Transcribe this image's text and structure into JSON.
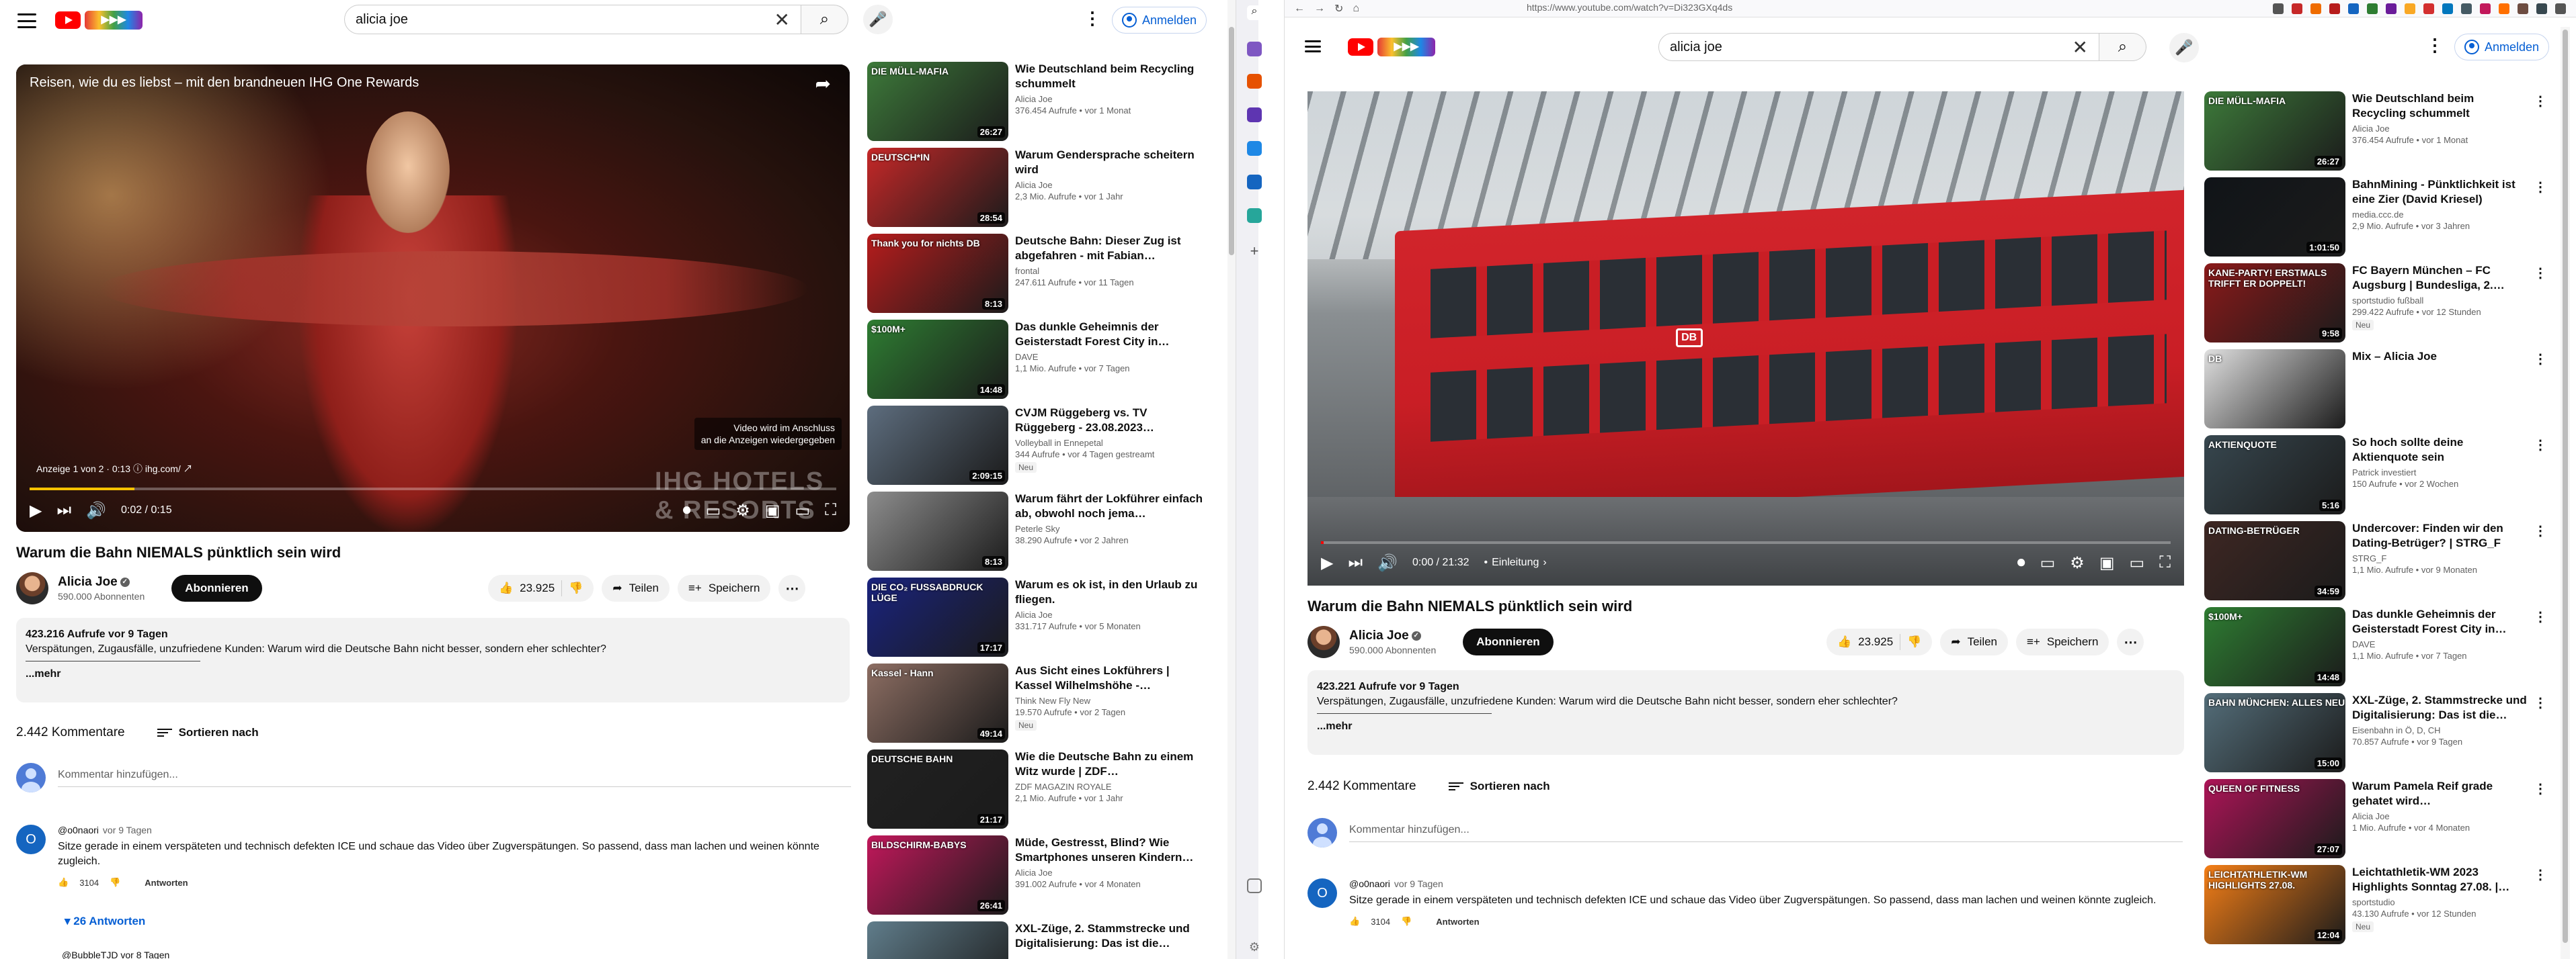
{
  "left": {
    "header": {
      "logo_text": "",
      "search_value": "alicia joe",
      "signin_label": "Anmelden"
    },
    "player": {
      "ad_title": "Reisen, wie du es liebst – mit den brandneuen IHG One Rewards",
      "ad_note_line1": "Video wird im Anschluss",
      "ad_note_line2": "an die Anzeigen wiedergegeben",
      "ad_info": "Anzeige 1 von 2 · 0:13  ⓘ  ihg.com/ ↗",
      "watermark": "IHG  HOTELS & RESORTS",
      "time": "0:02 / 0:15",
      "progress_percent": 13
    },
    "video": {
      "title": "Warum die Bahn NIEMALS pünktlich sein wird",
      "channel": "Alicia Joe",
      "subscribers": "590.000 Abonnenten",
      "subscribe_label": "Abonnieren",
      "likes": "23.925",
      "share_label": "Teilen",
      "save_label": "Speichern",
      "views_date": "423.216 Aufrufe  vor 9 Tagen",
      "description": "Verspätungen, Zugausfälle, unzufriedene Kunden: Warum wird die Deutsche Bahn nicht besser, sondern eher schlechter?",
      "more_label": "...mehr"
    },
    "comments": {
      "count": "2.442 Kommentare",
      "sort_label": "Sortieren nach",
      "add_placeholder": "Kommentar hinzufügen...",
      "first": {
        "avatar_letter": "O",
        "user": "@o0naori",
        "time": "vor 9 Tagen",
        "text": "Sitze gerade in einem verspäteten und technisch defekten ICE und schaue das Video über Zugverspätungen. So passend, dass man lachen und weinen könnte zugleich.",
        "likes": "3104",
        "reply_label": "Antworten"
      },
      "replies_label": "26 Antworten",
      "next_user": "@BubbleTJD  vor 8 Tagen"
    },
    "recommendations": [
      {
        "title": "Wie Deutschland beim Recycling schummelt",
        "channel": "Alicia Joe",
        "meta": "376.454 Aufrufe • vor 1 Monat",
        "duration": "26:27",
        "label": "DIE MÜLL-MAFIA",
        "color": "#3d7a3a",
        "badge": ""
      },
      {
        "title": "Warum Gendersprache scheitern wird",
        "channel": "Alicia Joe",
        "meta": "2,3 Mio. Aufrufe • vor 1 Jahr",
        "duration": "28:54",
        "label": "DEUTSCH*IN",
        "color": "#c62828",
        "badge": ""
      },
      {
        "title": "Deutsche Bahn: Dieser Zug ist abgefahren - mit Fabian…",
        "channel": "frontal",
        "meta": "247.611 Aufrufe • vor 11 Tagen",
        "duration": "8:13",
        "label": "Thank you for nichts DB",
        "color": "#b71c1c",
        "badge": ""
      },
      {
        "title": "Das dunkle Geheimnis der Geisterstadt Forest City in…",
        "channel": "DAVE",
        "meta": "1,1 Mio. Aufrufe • vor 7 Tagen",
        "duration": "14:48",
        "label": "$100M+",
        "color": "#2e7d32",
        "badge": ""
      },
      {
        "title": "CVJM Rüggeberg vs. TV Rüggeberg - 23.08.2023…",
        "channel": "Volleyball in Ennepetal",
        "meta": "344 Aufrufe • vor 4 Tagen gestreamt",
        "duration": "2:09:15",
        "label": "",
        "color": "#5d6d7e",
        "badge": "Neu"
      },
      {
        "title": "Warum fährt der Lokführer einfach ab, obwohl noch jema…",
        "channel": "Peterle Sky",
        "meta": "38.290 Aufrufe • vor 2 Jahren",
        "duration": "8:13",
        "label": "",
        "color": "#8d8d8d",
        "badge": ""
      },
      {
        "title": "Warum es ok ist, in den Urlaub zu fliegen.",
        "channel": "Alicia Joe",
        "meta": "331.717 Aufrufe • vor 5 Monaten",
        "duration": "17:17",
        "label": "DIE CO₂ FUSSABDRUCK LÜGE",
        "color": "#1a237e",
        "badge": ""
      },
      {
        "title": "Aus Sicht eines Lokführers | Kassel Wilhelmshöhe -…",
        "channel": "Think New Fly New",
        "meta": "19.570 Aufrufe • vor 2 Tagen",
        "duration": "49:14",
        "label": "Kassel - Hann",
        "color": "#8d6e63",
        "badge": "Neu"
      },
      {
        "title": "Wie die Deutsche Bahn zu einem Witz wurde | ZDF…",
        "channel": "ZDF MAGAZIN ROYALE",
        "meta": "2,1 Mio. Aufrufe • vor 1 Jahr",
        "duration": "21:17",
        "label": "DEUTSCHE BAHN",
        "color": "#212121",
        "badge": ""
      },
      {
        "title": "Müde, Gestresst, Blind? Wie Smartphones unseren Kindern…",
        "channel": "Alicia Joe",
        "meta": "391.002 Aufrufe • vor 4 Monaten",
        "duration": "26:41",
        "label": "BILDSCHIRM-BABYS",
        "color": "#c2185b",
        "badge": ""
      },
      {
        "title": "XXL-Züge, 2. Stammstrecke und Digitalisierung: Das ist die…",
        "channel": "",
        "meta": "",
        "duration": "",
        "label": "",
        "color": "#607d8b",
        "badge": ""
      }
    ]
  },
  "right": {
    "browser": {
      "url": "https://www.youtube.com/watch?v=Di323GXq4ds"
    },
    "header": {
      "search_value": "alicia joe",
      "signin_label": "Anmelden"
    },
    "player": {
      "time": "0:00 / 21:32",
      "chapter": "Einleitung",
      "progress_percent": 0
    },
    "video": {
      "title": "Warum die Bahn NIEMALS pünktlich sein wird",
      "channel": "Alicia Joe",
      "subscribers": "590.000 Abonnenten",
      "subscribe_label": "Abonnieren",
      "likes": "23.925",
      "share_label": "Teilen",
      "save_label": "Speichern",
      "views_date": "423.221 Aufrufe  vor 9 Tagen",
      "description": "Verspätungen, Zugausfälle, unzufriedene Kunden: Warum wird die Deutsche Bahn nicht besser, sondern eher schlechter?",
      "more_label": "...mehr"
    },
    "comments": {
      "count": "2.442 Kommentare",
      "sort_label": "Sortieren nach",
      "add_placeholder": "Kommentar hinzufügen...",
      "first": {
        "avatar_letter": "O",
        "user": "@o0naori",
        "time": "vor 9 Tagen",
        "text": "Sitze gerade in einem verspäteten und technisch defekten ICE und schaue das Video über Zugverspätungen. So passend, dass man lachen und weinen könnte zugleich.",
        "likes": "3104",
        "reply_label": "Antworten"
      }
    },
    "recommendations": [
      {
        "title": "Wie Deutschland beim Recycling schummelt",
        "channel": "Alicia Joe",
        "meta": "376.454 Aufrufe • vor 1 Monat",
        "duration": "26:27",
        "label": "DIE MÜLL-MAFIA",
        "color": "#3d7a3a",
        "badge": ""
      },
      {
        "title": "BahnMining - Pünktlichkeit ist eine Zier (David Kriesel)",
        "channel": "media.ccc.de",
        "meta": "2,9 Mio. Aufrufe • vor 3 Jahren",
        "duration": "1:01:50",
        "label": "",
        "color": "#101418",
        "badge": ""
      },
      {
        "title": "FC Bayern München – FC Augsburg | Bundesliga, 2.…",
        "channel": "sportstudio fußball",
        "meta": "299.422 Aufrufe • vor 12 Stunden",
        "duration": "9:58",
        "label": "KANE-PARTY! ERSTMALS TRIFFT ER DOPPELT!",
        "color": "#8b1a1a",
        "badge": "Neu"
      },
      {
        "title": "Mix – Alicia Joe",
        "channel": "",
        "meta": "",
        "duration": "",
        "label": "DB",
        "color": "#e0e0e0",
        "badge": ""
      },
      {
        "title": "So hoch sollte deine Aktienquote sein",
        "channel": "Patrick investiert",
        "meta": "150 Aufrufe • vor 2 Wochen",
        "duration": "5:16",
        "label": "AKTIENQUOTE",
        "color": "#37474f",
        "badge": ""
      },
      {
        "title": "Undercover: Finden wir den Dating-Betrüger? | STRG_F",
        "channel": "STRG_F",
        "meta": "1,1 Mio. Aufrufe • vor 9 Monaten",
        "duration": "34:59",
        "label": "DATING-BETRÜGER",
        "color": "#3e2723",
        "badge": ""
      },
      {
        "title": "Das dunkle Geheimnis der Geisterstadt Forest City in…",
        "channel": "DAVE",
        "meta": "1,1 Mio. Aufrufe • vor 7 Tagen",
        "duration": "14:48",
        "label": "$100M+",
        "color": "#2e7d32",
        "badge": ""
      },
      {
        "title": "XXL-Züge, 2. Stammstrecke und Digitalisierung: Das ist die…",
        "channel": "Eisenbahn in Ö, D, CH",
        "meta": "70.857 Aufrufe • vor 9 Tagen",
        "duration": "15:00",
        "label": "BAHN MÜNCHEN: ALLES NEU",
        "color": "#546e7a",
        "badge": ""
      },
      {
        "title": "Warum Pamela Reif grade gehatet wird…",
        "channel": "Alicia Joe",
        "meta": "1 Mio. Aufrufe • vor 4 Monaten",
        "duration": "27:07",
        "label": "QUEEN OF FITNESS",
        "color": "#ad1457",
        "badge": ""
      },
      {
        "title": "Leichtathletik-WM 2023 Highlights Sonntag 27.08. |…",
        "channel": "sportstudio",
        "meta": "43.130 Aufrufe • vor 12 Stunden",
        "duration": "12:04",
        "label": "LEICHTATHLETIK-WM HIGHLIGHTS 27.08.",
        "color": "#f57f17",
        "badge": "Neu"
      }
    ]
  },
  "colors": {
    "accent_red": "#ff0000",
    "link_blue": "#065fd4",
    "ad_yellow": "#f9c200"
  }
}
